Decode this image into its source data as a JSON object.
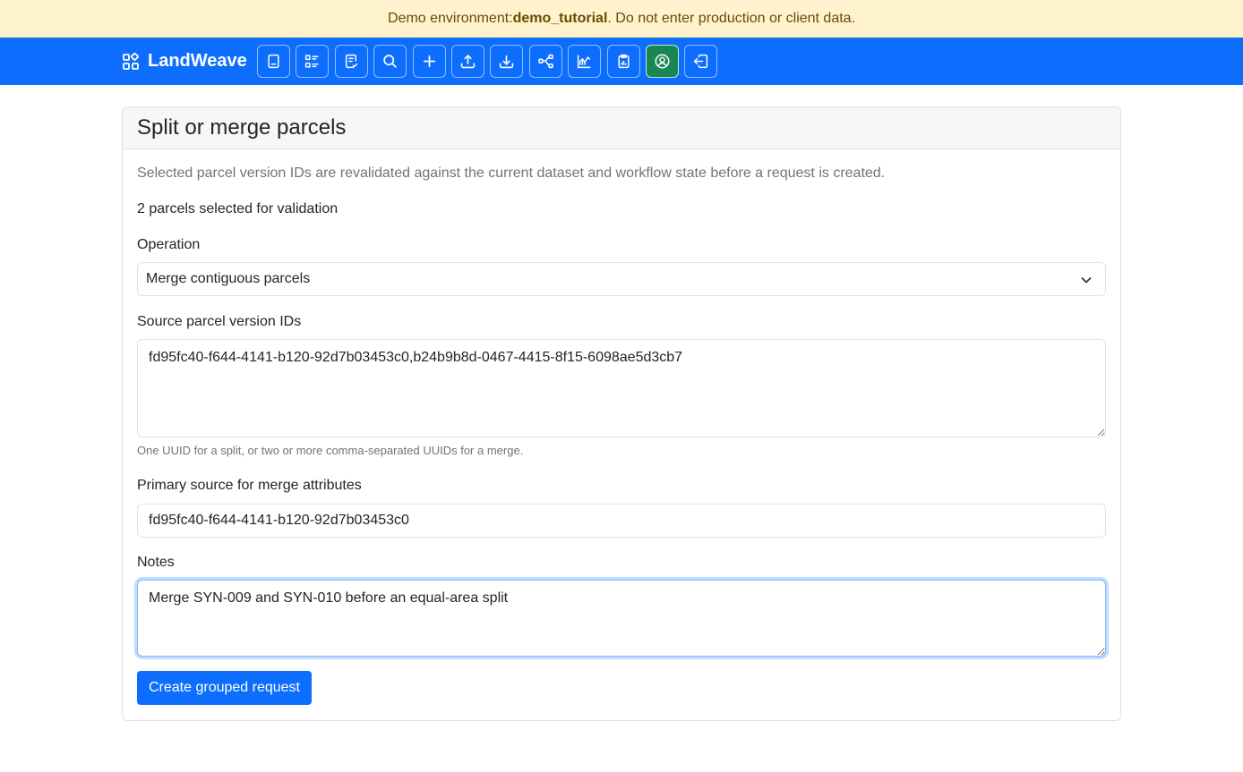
{
  "banner": {
    "prefix": "Demo environment: ",
    "environment": "demo_tutorial",
    "suffix": ". Do not enter production or client data."
  },
  "navbar": {
    "brand": "LandWeave",
    "buttons": [
      {
        "name": "book-icon",
        "active": false
      },
      {
        "name": "list-icon",
        "active": false
      },
      {
        "name": "checklist-icon",
        "active": false
      },
      {
        "name": "search-icon",
        "active": false
      },
      {
        "name": "plus-icon",
        "active": false
      },
      {
        "name": "upload-icon",
        "active": false
      },
      {
        "name": "download-icon",
        "active": false
      },
      {
        "name": "workflow-icon",
        "active": false
      },
      {
        "name": "chart-icon",
        "active": false
      },
      {
        "name": "clipboard-icon",
        "active": false
      },
      {
        "name": "user-icon",
        "active": true
      },
      {
        "name": "sign-out-icon",
        "active": false
      }
    ]
  },
  "card": {
    "title": "Split or merge parcels",
    "help_text": "Selected parcel version IDs are revalidated against the current dataset and workflow state before a request is created.",
    "selection_count": "2 parcels selected for validation"
  },
  "form": {
    "operation": {
      "label": "Operation",
      "selected": "Merge contiguous parcels"
    },
    "source_ids": {
      "label": "Source parcel version IDs",
      "value": "fd95fc40-f644-4141-b120-92d7b03453c0,b24b9b8d-0467-4415-8f15-6098ae5d3cb7",
      "hint": "One UUID for a split, or two or more comma-separated UUIDs for a merge."
    },
    "primary_source": {
      "label": "Primary source for merge attributes",
      "value": "fd95fc40-f644-4141-b120-92d7b03453c0"
    },
    "notes": {
      "label": "Notes",
      "value": "Merge SYN-009 and SYN-010 before an equal-area split"
    },
    "submit_label": "Create grouped request"
  },
  "colors": {
    "primary": "#0d6efd",
    "active_button": "#198754",
    "banner_background": "#fff3cd",
    "banner_text": "#664d03"
  }
}
